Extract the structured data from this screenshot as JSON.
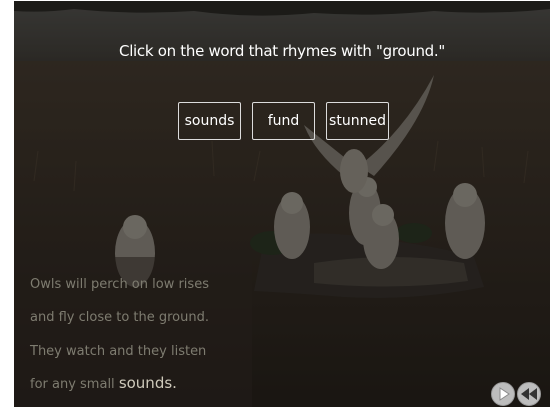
{
  "prompt": "Click on the word that rhymes with \"ground.\"",
  "choices": [
    "sounds",
    "fund",
    "stunned"
  ],
  "story": {
    "line1": "Owls will perch on low rises",
    "line2": "and fly close to the ground.",
    "line3": "They watch and they listen",
    "line4_prefix": "for any small ",
    "line4_word": "sounds."
  },
  "controls": {
    "play_icon": "play-icon",
    "rewind_icon": "rewind-icon"
  },
  "colors": {
    "overlay": "#000000",
    "prompt_text": "#ffffff",
    "story_text": "#7e7c70",
    "story_highlight": "#cfcabb",
    "button_border": "#dcdcdc"
  }
}
